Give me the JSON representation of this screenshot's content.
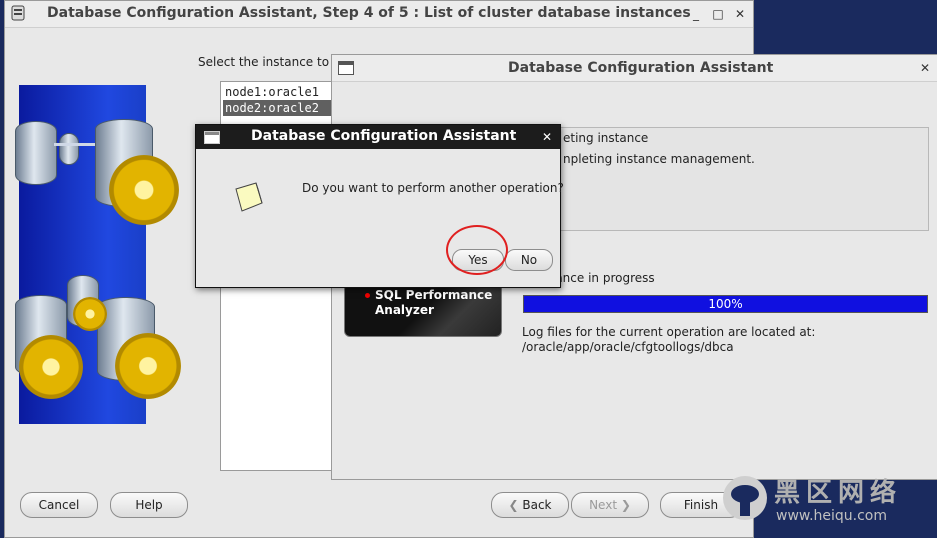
{
  "main_window": {
    "title": "Database Configuration Assistant, Step 4 of 5 : List of cluster database instances",
    "prompt": "Select the instance to c",
    "instances": [
      "node1:oracle1",
      "node2:oracle2"
    ],
    "selected_instance": "node2:oracle2",
    "buttons": {
      "cancel": "Cancel",
      "help": "Help",
      "back": "Back",
      "next": "Next",
      "finish": "Finish"
    }
  },
  "progress_window": {
    "title": "Database Configuration Assistant",
    "step1": "eting instance",
    "step2": "npleting instance management.",
    "status": "g instance in progress",
    "progress_value": 100,
    "progress_text": "100%",
    "log_line1": "Log files for the current operation are located at:",
    "log_line2": "/oracle/app/oracle/cfgtoollogs/dbca",
    "promo_line1": "SQL Performance",
    "promo_line2": "Analyzer"
  },
  "dialog": {
    "title": "Database Configuration Assistant",
    "question": "Do you want to perform another operation?",
    "yes": "Yes",
    "no": "No"
  },
  "watermark": {
    "chinese": "黑区网络",
    "url": "www.heiqu.com"
  },
  "colors": {
    "accent_blue": "#1010e0",
    "highlight_red": "#e02020",
    "dialog_title_bg": "#1c1c1c"
  }
}
